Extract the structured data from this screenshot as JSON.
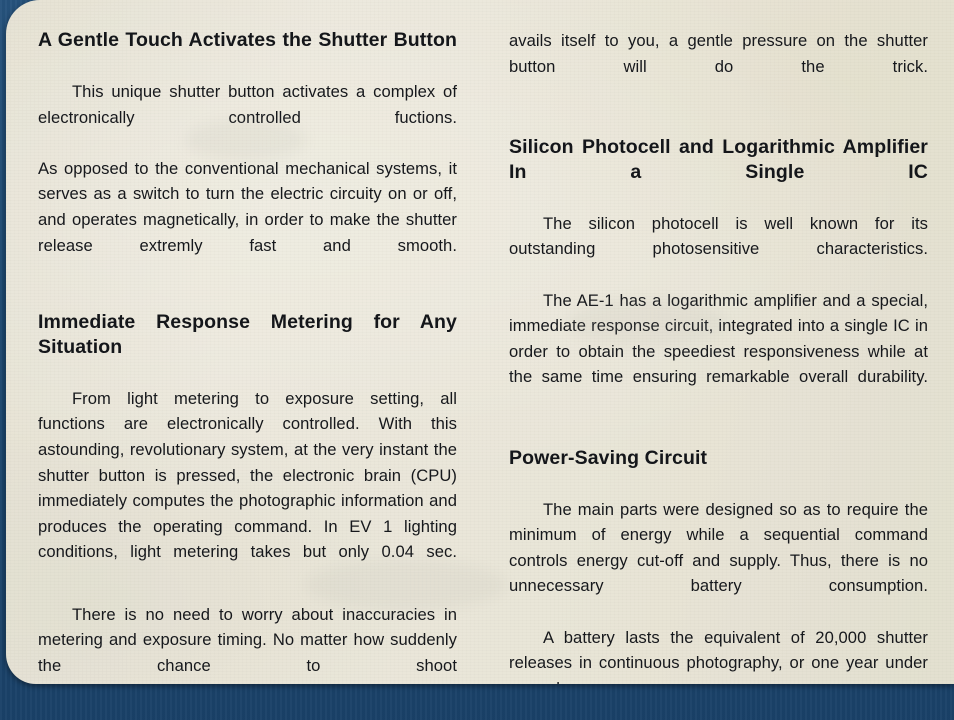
{
  "document": {
    "page_background_color": "#f3f1e9",
    "backdrop_color": "#1d4971",
    "text_color": "#16181c"
  },
  "left_column": {
    "heading_1": "A Gentle Touch Activates the Shutter Button",
    "paragraph_1": "This unique shutter button activates a complex of electronically controlled fuctions.",
    "paragraph_2": "As opposed to the conventional mechanical systems, it serves as a switch to turn the electric circuity on or off, and operates magnetically, in order to make the shutter release extremly fast and smooth.",
    "heading_2": "Immediate Response Metering for Any Situation",
    "paragraph_3": "From light metering to exposure setting, all functions are electronically controlled. With this astounding, revolutionary system, at the very instant the shutter button is pressed, the electronic brain (CPU) immediately computes the photographic information and produces the operating command. In EV 1 lighting conditions, light metering takes but only 0.04 sec.",
    "paragraph_4": "There is no need to worry about inaccuracies in metering and exposure timing. No matter how suddenly the chance to shoot"
  },
  "right_column": {
    "paragraph_1": "avails itself to you, a gentle pressure on the shutter button will do the trick.",
    "heading_1": "Silicon Photocell and Logarithmic Amplifier In a Single IC",
    "paragraph_2": "The silicon photocell is well known for its outstanding photosensitive characteristics.",
    "paragraph_3": "The AE-1 has a logarithmic amplifier and a special, immediate response circuit, integrated into a single IC in order to obtain the speediest responsiveness while at the same time ensuring remarkable overall durability.",
    "heading_2": "Power-Saving Circuit",
    "paragraph_4": "The main parts were designed so as to require the minimum of energy while a sequential command controls energy cut-off and supply. Thus, there is no unnecessary battery consumption.",
    "paragraph_5": "A battery lasts the equivalent of 20,000 shutter releases in continuous photography, or one year under normal use."
  }
}
